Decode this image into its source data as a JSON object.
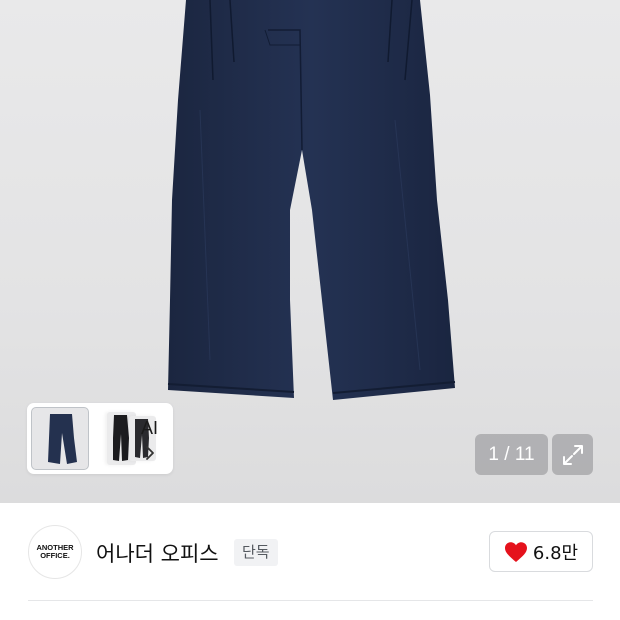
{
  "gallery": {
    "image_icon": "wide-pleated-denim-trousers",
    "similar": {
      "label": "AI",
      "chevron_icon": "chevron-right-icon"
    },
    "counter": "1 / 11",
    "fullscreen_icon": "expand-icon"
  },
  "brand": {
    "logo_line1": "ANOTHER",
    "logo_line2": "OFFICE.",
    "name": "어나더 오피스",
    "badge": "단독"
  },
  "like": {
    "icon": "heart-icon",
    "count": "6.8만",
    "color": "#e5121c"
  }
}
